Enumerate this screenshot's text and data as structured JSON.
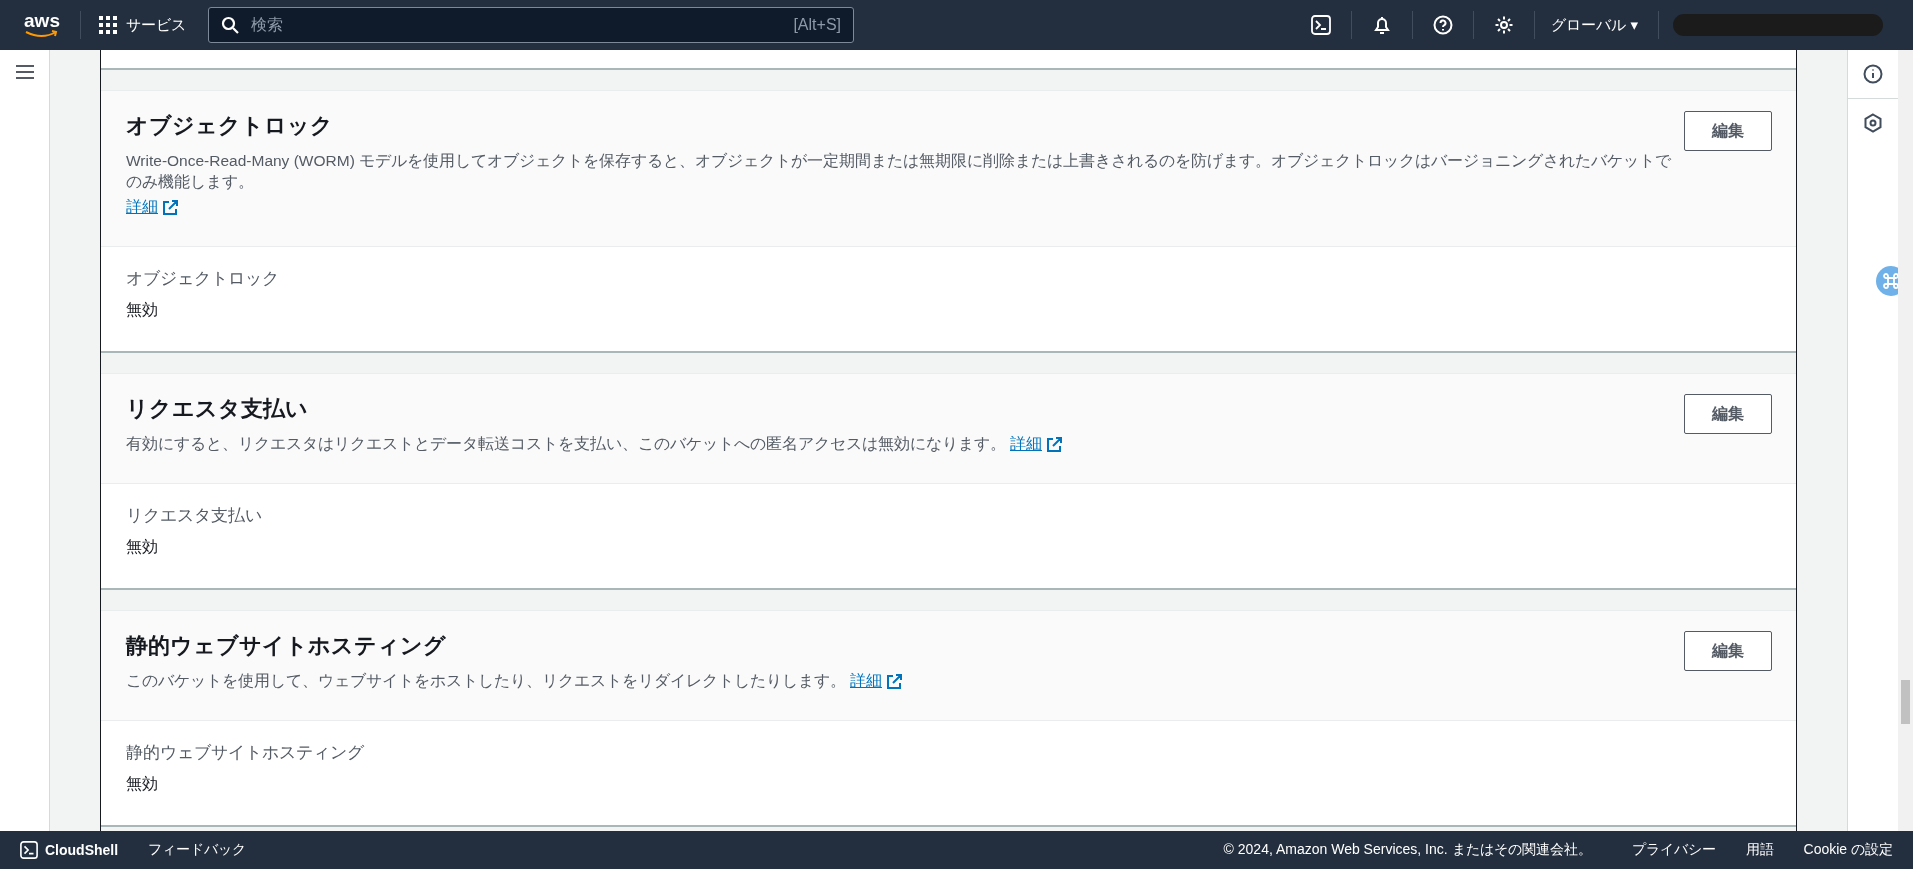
{
  "top_bar": {
    "logo": "aws",
    "services": "サービス",
    "search": {
      "placeholder": "検索",
      "shortcut": "[Alt+S]"
    },
    "region": "グローバル ▾"
  },
  "sections": [
    {
      "title": "オブジェクトロック",
      "description": "Write-Once-Read-Many (WORM) モデルを使用してオブジェクトを保存すると、オブジェクトが一定期間または無期限に削除または上書きされるのを防げます。オブジェクトロックはバージョニングされたバケットでのみ機能します。",
      "link": "詳細",
      "button": "編集",
      "field_label": "オブジェクトロック",
      "field_value": "無効"
    },
    {
      "title": "リクエスタ支払い",
      "description": "有効にすると、リクエスタはリクエストとデータ転送コストを支払い、このバケットへの匿名アクセスは無効になります。",
      "link": "詳細",
      "button": "編集",
      "field_label": "リクエスタ支払い",
      "field_value": "無効"
    },
    {
      "title": "静的ウェブサイトホスティング",
      "description": "このバケットを使用して、ウェブサイトをホストしたり、リクエストをリダイレクトしたりします。",
      "link": "詳細",
      "button": "編集",
      "field_label": "静的ウェブサイトホスティング",
      "field_value": "無効"
    }
  ],
  "footer": {
    "cloudshell": "CloudShell",
    "feedback": "フィードバック",
    "copyright": "© 2024, Amazon Web Services, Inc. またはその関連会社。",
    "links": [
      "プライバシー",
      "用語",
      "Cookie の設定"
    ]
  }
}
